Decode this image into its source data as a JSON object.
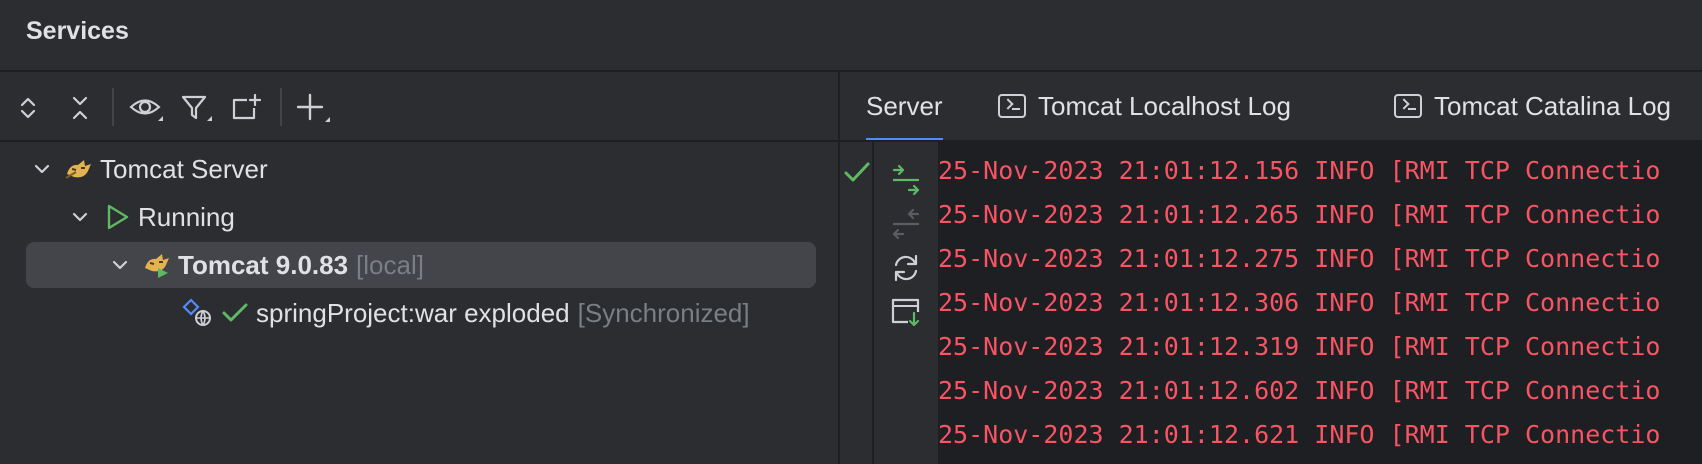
{
  "window": {
    "title": "Services"
  },
  "toolbar": {
    "icons": [
      "expand-all-icon",
      "collapse-all-icon",
      "eye-icon",
      "filter-icon",
      "new-group-icon",
      "add-icon"
    ]
  },
  "tree": {
    "server": "Tomcat Server",
    "running": "Running",
    "instance_name": "Tomcat 9.0.83",
    "instance_suffix": "[local]",
    "artifact_name": "springProject:war exploded",
    "artifact_status": "[Synchronized]"
  },
  "tabs": [
    {
      "label": "Server",
      "active": true
    },
    {
      "label": "Tomcat Localhost Log",
      "active": false
    },
    {
      "label": "Tomcat Catalina Log",
      "active": false
    }
  ],
  "log": {
    "partial_line": "",
    "lines": [
      "25-Nov-2023 21:01:12.156 INFO [RMI TCP Connectio",
      "25-Nov-2023 21:01:12.265 INFO [RMI TCP Connectio",
      "25-Nov-2023 21:01:12.275 INFO [RMI TCP Connectio",
      "25-Nov-2023 21:01:12.306 INFO [RMI TCP Connectio",
      "25-Nov-2023 21:01:12.319 INFO [RMI TCP Connectio",
      "25-Nov-2023 21:01:12.602 INFO [RMI TCP Connectio",
      "25-Nov-2023 21:01:12.621 INFO [RMI TCP Connectio"
    ]
  },
  "colors": {
    "accent": "#548af7",
    "success": "#5fb865",
    "error_text": "#f75464"
  }
}
